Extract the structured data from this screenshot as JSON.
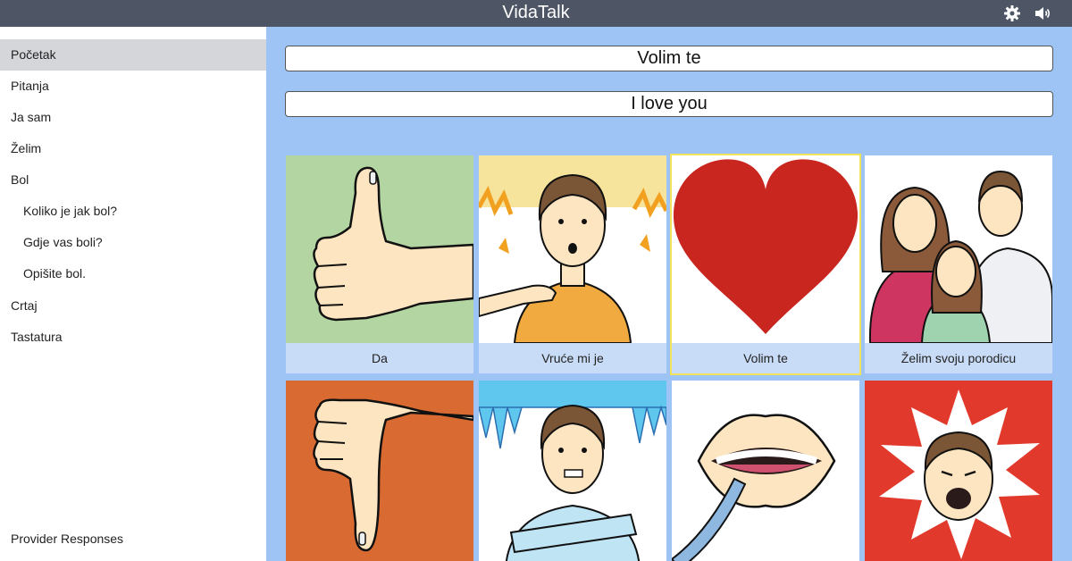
{
  "app": {
    "title": "VidaTalk"
  },
  "header_icons": {
    "settings": "gear-icon",
    "sound": "speaker-icon"
  },
  "sidebar": {
    "items": [
      {
        "label": "Početak",
        "active": true,
        "sub": false
      },
      {
        "label": "Pitanja",
        "active": false,
        "sub": false
      },
      {
        "label": "Ja sam",
        "active": false,
        "sub": false
      },
      {
        "label": "Želim",
        "active": false,
        "sub": false
      },
      {
        "label": "Bol",
        "active": false,
        "sub": false
      },
      {
        "label": "Koliko je jak bol?",
        "active": false,
        "sub": true
      },
      {
        "label": "Gdje vas boli?",
        "active": false,
        "sub": true
      },
      {
        "label": "Opišite bol.",
        "active": false,
        "sub": true
      },
      {
        "label": "Crtaj",
        "active": false,
        "sub": false
      },
      {
        "label": "Tastatura",
        "active": false,
        "sub": false
      }
    ],
    "footer": "Provider Responses"
  },
  "phrase": {
    "native": "Volim te",
    "translation": "I love you"
  },
  "tiles": [
    {
      "label": "Da",
      "icon": "thumbs-up",
      "selected": false
    },
    {
      "label": "Vruće mi je",
      "icon": "hot-person",
      "selected": false
    },
    {
      "label": "Volim te",
      "icon": "heart",
      "selected": true
    },
    {
      "label": "Želim svoju porodicu",
      "icon": "family",
      "selected": false
    },
    {
      "label": "",
      "icon": "thumbs-down",
      "selected": false
    },
    {
      "label": "",
      "icon": "cold-person",
      "selected": false
    },
    {
      "label": "",
      "icon": "mouth-suction",
      "selected": false
    },
    {
      "label": "",
      "icon": "pain-face",
      "selected": false
    }
  ],
  "colors": {
    "topbar": "#4e5565",
    "main_bg": "#9ec4f5",
    "selected_outline": "#f2e35a",
    "heart": "#c8261f"
  }
}
